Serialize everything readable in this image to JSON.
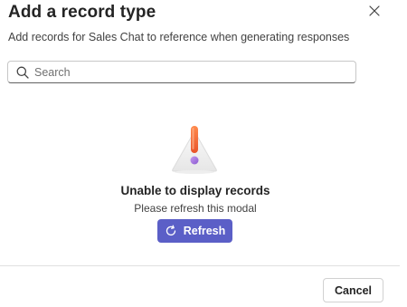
{
  "dialog": {
    "title": "Add a record type",
    "subtitle": "Add records for Sales Chat to reference when generating responses",
    "close_icon": "close-icon"
  },
  "search": {
    "placeholder": "Search",
    "value": "",
    "icon": "search-icon"
  },
  "empty_state": {
    "illustration": "warning-exclamation-icon",
    "title": "Unable to display records",
    "message": "Please refresh this modal",
    "refresh_label": "Refresh",
    "refresh_icon": "refresh-icon"
  },
  "footer": {
    "cancel_label": "Cancel"
  },
  "colors": {
    "primary": "#5b5fc7",
    "exclamation_orange": "#f26b3a",
    "exclamation_dot": "#9b6bd6",
    "divider": "#e0e0e0"
  }
}
